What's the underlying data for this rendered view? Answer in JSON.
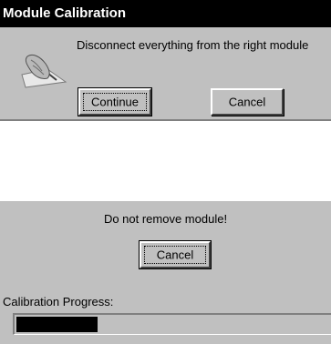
{
  "calibration_dialog": {
    "title": "Module Calibration",
    "message": "Disconnect everything from the right module",
    "icon": "hand-pen-icon",
    "continue_label": "Continue",
    "cancel_label": "Cancel"
  },
  "progress_panel": {
    "warning": "Do not remove module!",
    "cancel_label": "Cancel",
    "progress_label": "Calibration Progress:",
    "progress_fraction": 0.26
  },
  "colors": {
    "window_face": "#c0c0c0",
    "title_bar": "#000000",
    "progress_fill": "#000000"
  }
}
